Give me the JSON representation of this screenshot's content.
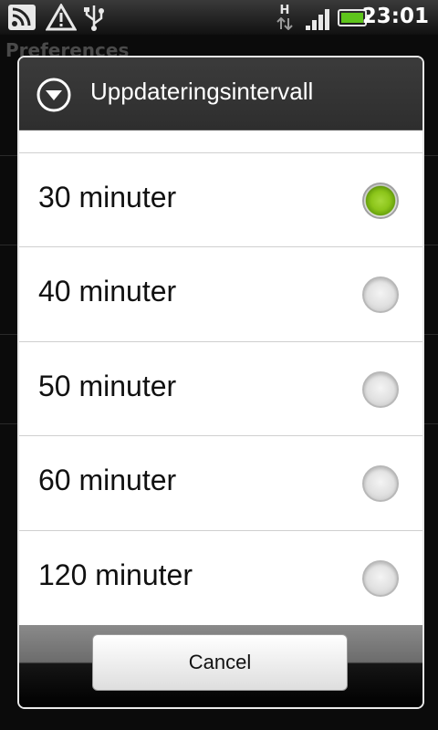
{
  "status_bar": {
    "time": "23:01",
    "network_type": "H",
    "icons": [
      "rss-feed-icon",
      "warning-icon",
      "usb-icon",
      "network-type-icon",
      "signal-icon",
      "battery-icon"
    ]
  },
  "background": {
    "title": "Preferences"
  },
  "dialog": {
    "title": "Uppdateringsintervall",
    "icon": "chevron-down-circle-icon",
    "options": [
      {
        "label": "30 minuter",
        "selected": true
      },
      {
        "label": "40 minuter",
        "selected": false
      },
      {
        "label": "50 minuter",
        "selected": false
      },
      {
        "label": "60 minuter",
        "selected": false
      },
      {
        "label": "120 minuter",
        "selected": false
      }
    ],
    "cancel_label": "Cancel"
  },
  "colors": {
    "accent_green": "#8cc51a",
    "header_bg": "#333333",
    "list_bg": "#ffffff"
  }
}
